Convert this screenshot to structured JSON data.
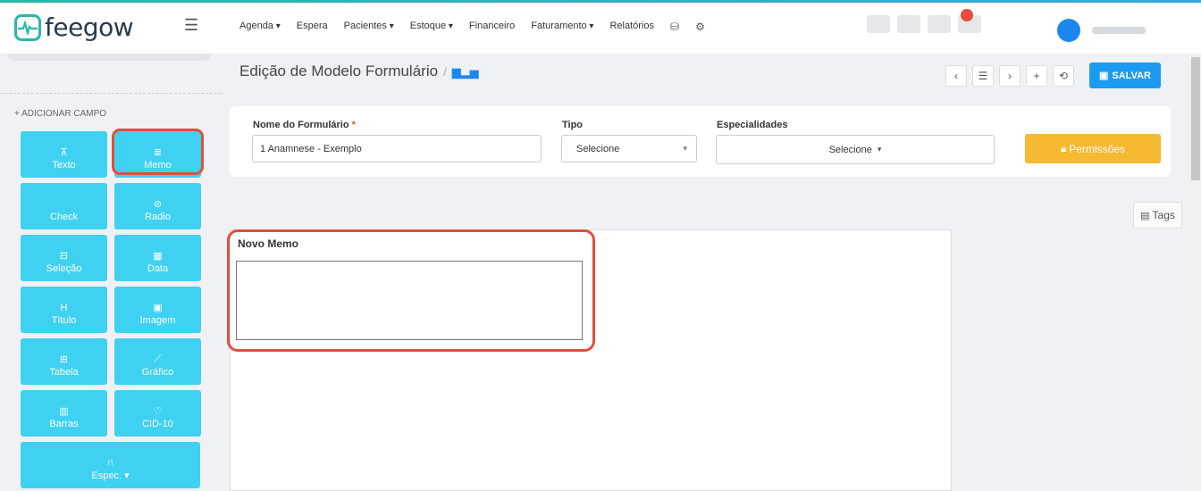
{
  "app": {
    "logo_text": "feegow",
    "brand_color": "#2bb8a6"
  },
  "nav": {
    "items": [
      {
        "label": "Agenda",
        "dropdown": true
      },
      {
        "label": "Espera",
        "dropdown": false
      },
      {
        "label": "Pacientes",
        "dropdown": true
      },
      {
        "label": "Estoque",
        "dropdown": true
      },
      {
        "label": "Financeiro",
        "dropdown": false
      },
      {
        "label": "Faturamento",
        "dropdown": true
      },
      {
        "label": "Relatórios",
        "dropdown": false
      }
    ],
    "icons": [
      "database-icon",
      "gear-icon"
    ]
  },
  "sidebar": {
    "title": "+ ADICIONAR CAMPO",
    "fields": [
      {
        "label": "Texto",
        "icon": "text-icon",
        "glyph": "⊼"
      },
      {
        "label": "Memo",
        "icon": "memo-icon",
        "glyph": "≣"
      },
      {
        "label": "Check",
        "icon": "check-icon",
        "glyph": ""
      },
      {
        "label": "Radio",
        "icon": "radio-icon",
        "glyph": "⊘"
      },
      {
        "label": "Seleção",
        "icon": "select-icon",
        "glyph": "⊟"
      },
      {
        "label": "Data",
        "icon": "calendar-icon",
        "glyph": "▦"
      },
      {
        "label": "Título",
        "icon": "heading-icon",
        "glyph": "H"
      },
      {
        "label": "Imagem",
        "icon": "image-icon",
        "glyph": "▣"
      },
      {
        "label": "Tabela",
        "icon": "table-icon",
        "glyph": "⊞"
      },
      {
        "label": "Gráfico",
        "icon": "chart-icon",
        "glyph": "⟋"
      },
      {
        "label": "Barras",
        "icon": "barcode-icon",
        "glyph": "▥"
      },
      {
        "label": "CID-10",
        "icon": "stethoscope-icon",
        "glyph": "♡"
      },
      {
        "label": "Espec.",
        "icon": "headphones-icon",
        "glyph": "∩"
      }
    ],
    "field_color": "#3fd1f2"
  },
  "header": {
    "title": "Edição de Modelo Formulário",
    "separator": "/",
    "save_label": "SALVAR",
    "toolbar_glyphs": [
      "‹",
      "☰",
      "›",
      "+",
      "⟲"
    ]
  },
  "form": {
    "name_label": "Nome do Formulário",
    "name_required_mark": "*",
    "name_value": "1 Anamnese - Exemplo",
    "tipo_label": "Tipo",
    "tipo_value": "Selecione",
    "espec_label": "Especialidades",
    "espec_value": "Selecione",
    "permissions_label": "Permissões"
  },
  "canvas": {
    "tags_label": "Tags",
    "field_label": "Novo Memo",
    "memo_value": ""
  },
  "colors": {
    "highlight": "#e0503a",
    "primary": "#1c9bf0",
    "warning": "#f7b832"
  }
}
